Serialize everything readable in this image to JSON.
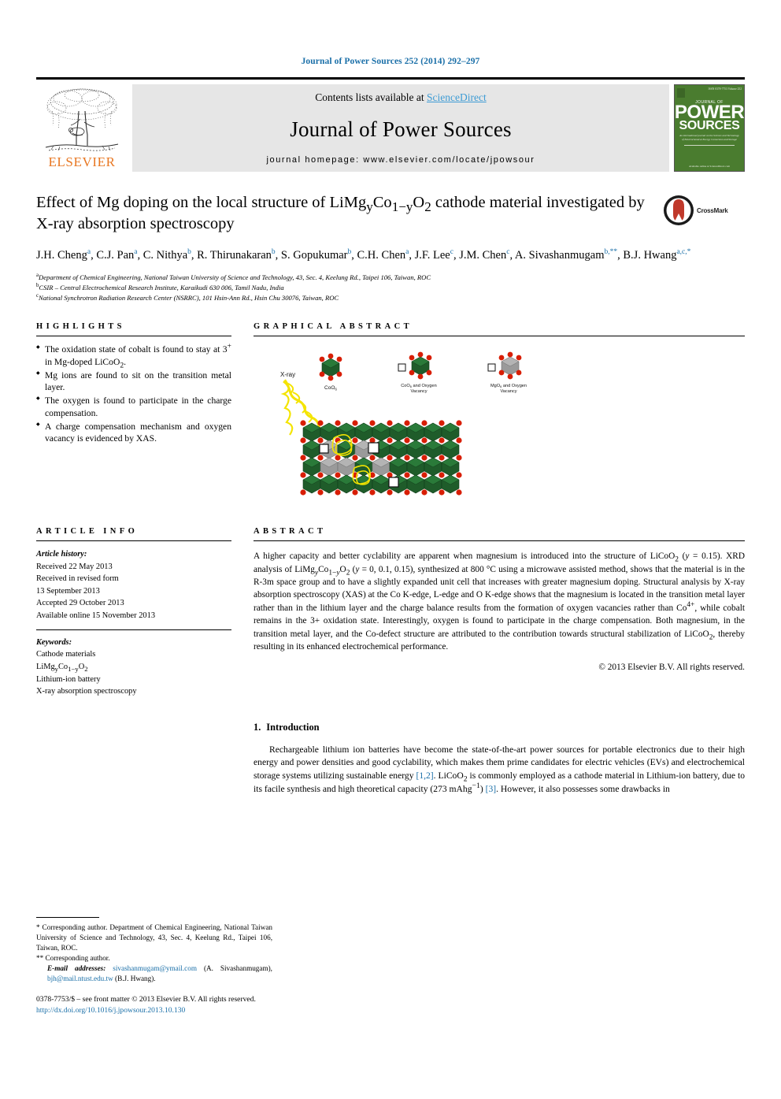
{
  "running_head": "Journal of Power Sources 252 (2014) 292–297",
  "banner": {
    "contents_prefix": "Contents lists available at ",
    "sciencedirect": "ScienceDirect",
    "journal_name": "Journal of Power Sources",
    "homepage": "journal homepage: www.elsevier.com/locate/jpowsour",
    "publisher_word": "ELSEVIER",
    "accent_orange": "#E87722",
    "link_blue": "#3d9bd4",
    "banner_bg": "#e6e6e6",
    "cover": {
      "journal_of": "JOURNAL OF",
      "power": "POWER",
      "sources": "SOURCES",
      "blurb": "An international journal on the Science and Technology of Electrochemical Energy Conversion and Storage",
      "foot": "Available online at\nScienceDirect.com",
      "tiny_top": "ISSN 0378-7753\nVolume 252",
      "bg": "#4a7c2f"
    }
  },
  "title": {
    "line1_a": "Effect of Mg doping on the local structure of LiMg",
    "sub_y1": "y",
    "line1_b": "Co",
    "sub_1y": "1−y",
    "line1_c": "O",
    "sub_2": "2",
    "line1_d": " cathode",
    "line2": "material investigated by X-ray absorption spectroscopy",
    "crossmark_label": "CrossMark"
  },
  "authors": {
    "list": [
      {
        "name": "J.H. Cheng",
        "marks": "a"
      },
      {
        "name": "C.J. Pan",
        "marks": "a"
      },
      {
        "name": "C. Nithya",
        "marks": "b"
      },
      {
        "name": "R. Thirunakaran",
        "marks": "b"
      },
      {
        "name": "S. Gopukumar",
        "marks": "b"
      },
      {
        "name": "C.H. Chen",
        "marks": "a"
      },
      {
        "name": "J.F. Lee",
        "marks": "c"
      },
      {
        "name": "J.M. Chen",
        "marks": "c"
      },
      {
        "name": "A. Sivashanmugam",
        "marks": "b,**"
      },
      {
        "name": "B.J. Hwang",
        "marks": "a,c,*"
      }
    ]
  },
  "affiliations": [
    {
      "mark": "a",
      "text": "Department of Chemical Engineering, National Taiwan University of Science and Technology, 43, Sec. 4, Keelung Rd., Taipei 106, Taiwan, ROC"
    },
    {
      "mark": "b",
      "text": "CSIR – Central Electrochemical Research Institute, Karaikudi 630 006, Tamil Nadu, India"
    },
    {
      "mark": "c",
      "text": "National Synchrotron Radiation Research Center (NSRRC), 101 Hsin-Ann Rd., Hsin Chu 30076, Taiwan, ROC"
    }
  ],
  "highlights": {
    "heading": "HIGHLIGHTS",
    "items": [
      "The oxidation state of cobalt is found to stay at 3+ in Mg-doped LiCoO2.",
      "Mg ions are found to sit on the transition metal layer.",
      "The oxygen is found to participate in the charge compensation.",
      "A charge compensation mechanism and oxygen vacancy is evidenced by XAS."
    ]
  },
  "graphical_abstract": {
    "heading": "GRAPHICAL ABSTRACT",
    "xray_label": "X-ray",
    "legend": [
      "CoO6",
      "CoO6 and Oxygen Vacancy",
      "MgO6 and Oxygen Vacancy"
    ],
    "colors": {
      "cobalt_octahedron": "#1f5c2a",
      "magnesium_octahedron": "#9a9a9a",
      "oxygen": "#d81e05",
      "xray_beam": "#f4e400"
    }
  },
  "article_info": {
    "heading": "ARTICLE INFO",
    "history_label": "Article history:",
    "history": [
      "Received 22 May 2013",
      "Received in revised form",
      "13 September 2013",
      "Accepted 29 October 2013",
      "Available online 15 November 2013"
    ],
    "keywords_label": "Keywords:",
    "keywords": [
      "Cathode materials",
      "LiMgyCo1−yO2",
      "Lithium-ion battery",
      "X-ray absorption spectroscopy"
    ]
  },
  "abstract": {
    "heading": "ABSTRACT",
    "text": "A higher capacity and better cyclability are apparent when magnesium is introduced into the structure of LiCoO2 (y = 0.15). XRD analysis of LiMgyCo1−yO2 (y = 0, 0.1, 0.15), synthesized at 800 °C using a microwave assisted method, shows that the material is in the R-3m space group and to have a slightly expanded unit cell that increases with greater magnesium doping. Structural analysis by X-ray absorption spectroscopy (XAS) at the Co K-edge, L-edge and O K-edge shows that the magnesium is located in the transition metal layer rather than in the lithium layer and the charge balance results from the formation of oxygen vacancies rather than Co4+, while cobalt remains in the 3+ oxidation state. Interestingly, oxygen is found to participate in the charge compensation. Both magnesium, in the transition metal layer, and the Co-defect structure are attributed to the contribution towards structural stabilization of LiCoO2, thereby resulting in its enhanced electrochemical performance.",
    "copyright": "© 2013 Elsevier B.V. All rights reserved."
  },
  "introduction": {
    "number": "1.",
    "heading": "Introduction",
    "paragraph_pre": "Rechargeable lithium ion batteries have become the state-of-the-art power sources for portable electronics due to their high energy and power densities and good cyclability, which makes them prime candidates for electric vehicles (EVs) and electrochemical storage systems utilizing sustainable energy ",
    "cite1": "[1,2]",
    "paragraph_mid": ". LiCoO2 is commonly employed as a cathode material in Lithium-ion battery, due to its facile synthesis and high theoretical capacity (273 mAhg−1) ",
    "cite2": "[3]",
    "paragraph_end": ". However, it also possesses some drawbacks in"
  },
  "footnotes": {
    "star_note": "* Corresponding author. Department of Chemical Engineering, National Taiwan University of Science and Technology, 43, Sec. 4, Keelung Rd., Taipei 106, Taiwan, ROC.",
    "dstar_note": "** Corresponding author.",
    "email_label": "E-mail addresses:",
    "email1": "sivashanmugam@ymail.com",
    "email1_who": "(A. Sivashanmugam),",
    "email2a": "bjh@mail.",
    "email2b": "ntust.edu.tw",
    "email2_who": "(B.J. Hwang)."
  },
  "issn": {
    "line": "0378-7753/$ – see front matter © 2013 Elsevier B.V. All rights reserved.",
    "doi": "http://dx.doi.org/10.1016/j.jpowsour.2013.10.130"
  }
}
